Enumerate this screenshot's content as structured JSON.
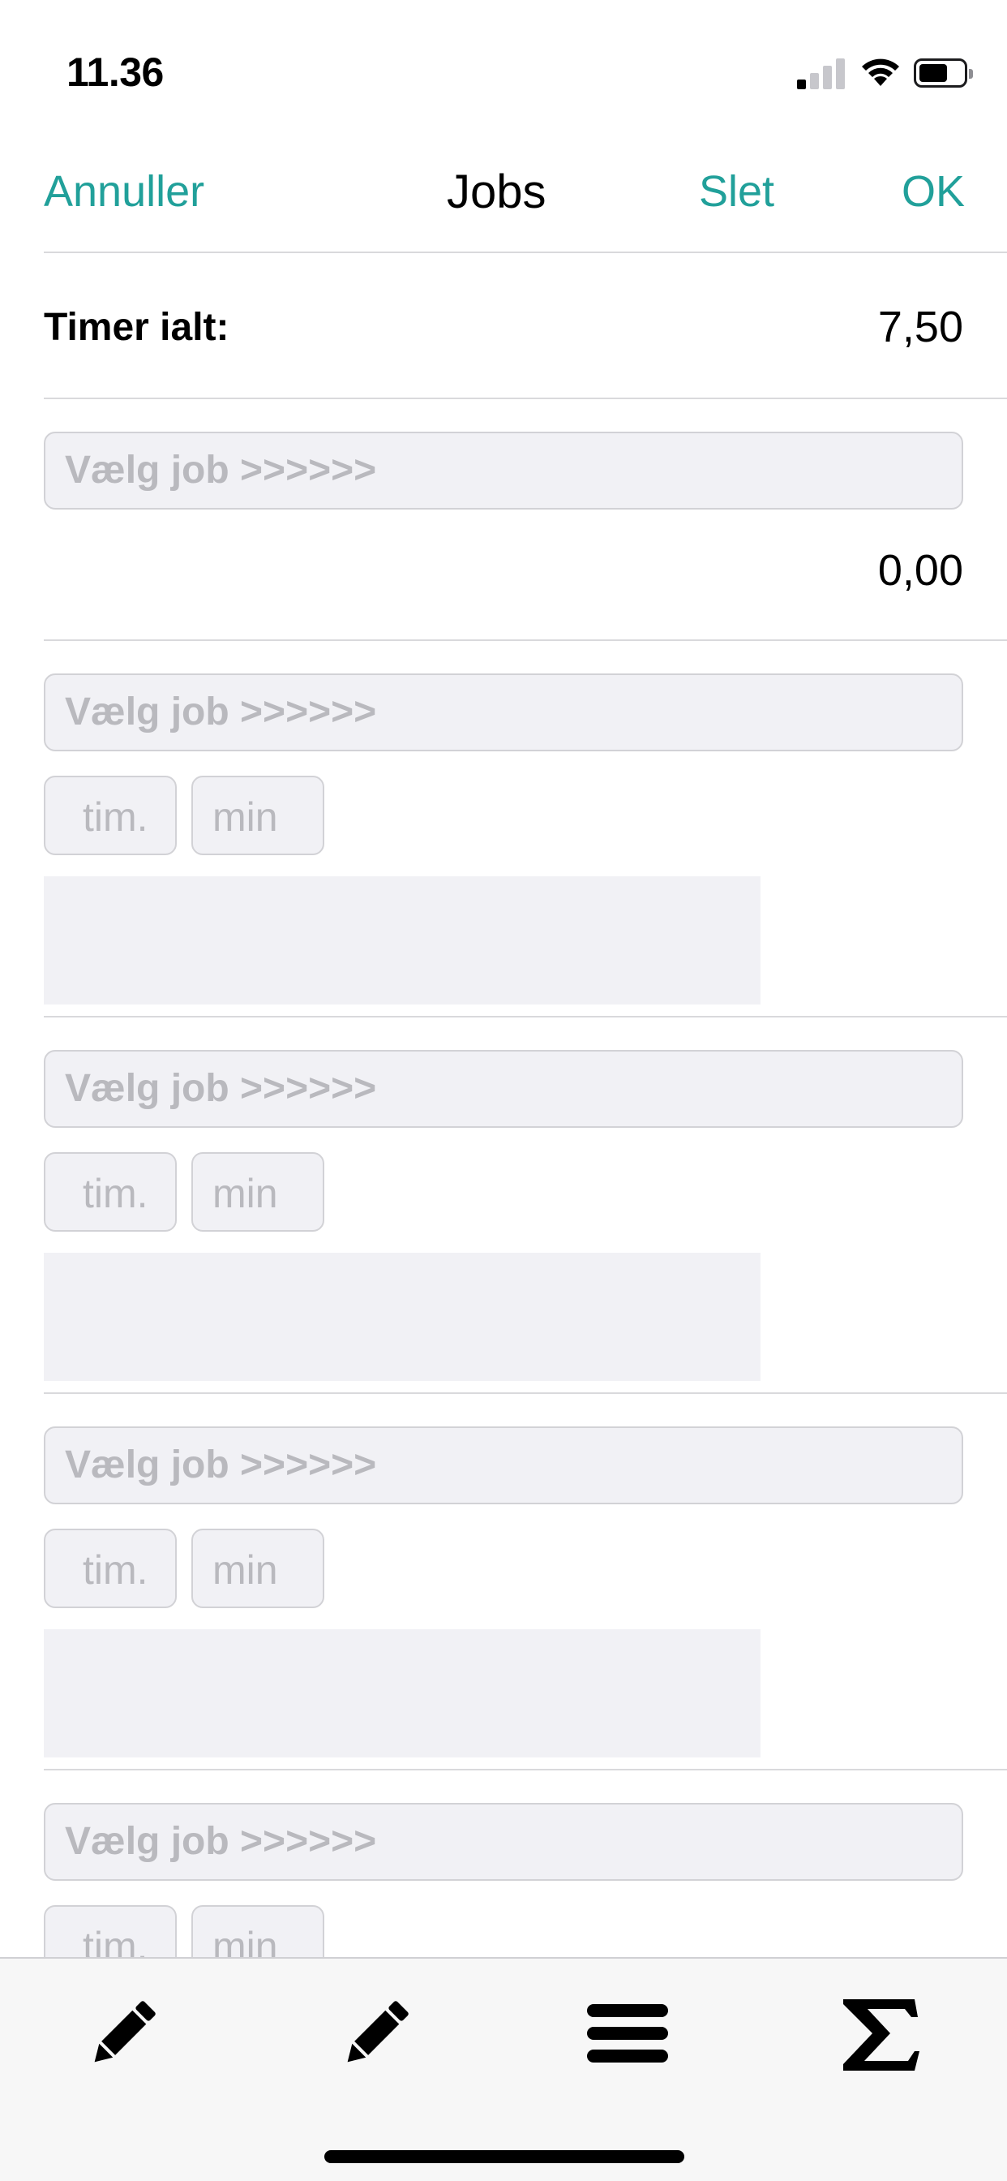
{
  "status_bar": {
    "time": "11.36"
  },
  "nav": {
    "cancel_label": "Annuller",
    "title": "Jobs",
    "delete_label": "Slet",
    "ok_label": "OK"
  },
  "summary": {
    "total_label": "Timer ialt:",
    "total_value": "7,50"
  },
  "jobs": [
    {
      "select_placeholder": "Vælg job >>>>>>",
      "hours_value": "0,00"
    },
    {
      "select_placeholder": "Vælg job >>>>>>",
      "hours_placeholder": "tim.",
      "minutes_placeholder": "min",
      "note": ""
    },
    {
      "select_placeholder": "Vælg job >>>>>>",
      "hours_placeholder": "tim.",
      "minutes_placeholder": "min",
      "note": ""
    },
    {
      "select_placeholder": "Vælg job >>>>>>",
      "hours_placeholder": "tim.",
      "minutes_placeholder": "min",
      "note": ""
    },
    {
      "select_placeholder": "Vælg job >>>>>>",
      "hours_placeholder": "tim.",
      "minutes_placeholder": "min"
    }
  ],
  "tab_bar": {
    "icons": [
      "pencil-icon",
      "pencil-icon",
      "menu-icon",
      "sigma-icon"
    ]
  },
  "colors": {
    "accent": "#21a09a",
    "field_background": "#f1f1f5",
    "placeholder_text": "#b9b9be"
  }
}
